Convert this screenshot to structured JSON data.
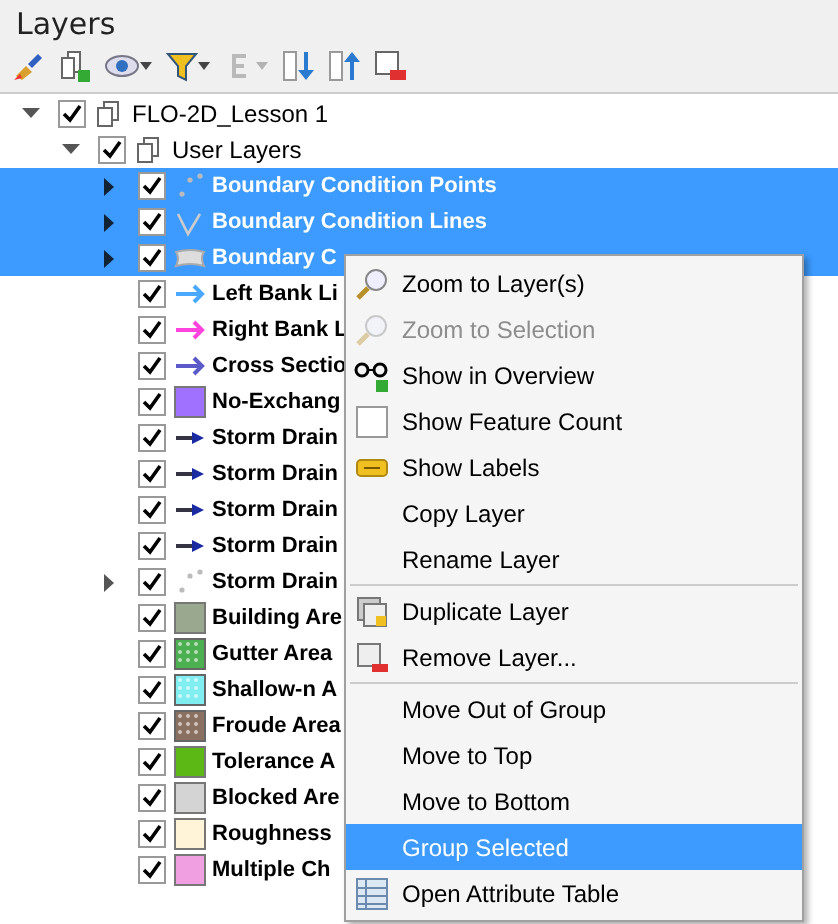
{
  "panel": {
    "title": "Layers"
  },
  "toolbar": [
    {
      "kind": "brush",
      "disabled": false,
      "dropdown": false
    },
    {
      "kind": "add-group",
      "disabled": false,
      "dropdown": false
    },
    {
      "kind": "eye",
      "disabled": false,
      "dropdown": true
    },
    {
      "kind": "filter",
      "disabled": false,
      "dropdown": true
    },
    {
      "kind": "epsilon",
      "disabled": true,
      "dropdown": true
    },
    {
      "kind": "expand",
      "disabled": false,
      "dropdown": false
    },
    {
      "kind": "collapse",
      "disabled": false,
      "dropdown": false
    },
    {
      "kind": "remove",
      "disabled": false,
      "dropdown": false
    }
  ],
  "tree": [
    {
      "label": "FLO-2D_Lesson 1",
      "kind": "group",
      "checked": true,
      "expanded": true,
      "selected": false,
      "children": [
        {
          "label": "User Layers",
          "kind": "group",
          "checked": true,
          "expanded": true,
          "selected": false,
          "children": [
            {
              "label": "Boundary Condition Points",
              "kind": "points",
              "checked": true,
              "collapsed": true,
              "selected": true
            },
            {
              "label": "Boundary Condition Lines",
              "kind": "line",
              "checked": true,
              "collapsed": true,
              "selected": true
            },
            {
              "label": "Boundary C",
              "kind": "polygon",
              "checked": true,
              "collapsed": true,
              "selected": true
            },
            {
              "label": "Left Bank Li",
              "kind": "arrow",
              "color": "#4aa8ff",
              "checked": true,
              "collapsed": false,
              "selected": false
            },
            {
              "label": "Right Bank L",
              "kind": "arrow",
              "color": "#ff44dd",
              "checked": true,
              "collapsed": false,
              "selected": false
            },
            {
              "label": "Cross Sectio",
              "kind": "arrow",
              "color": "#5a5ac8",
              "checked": true,
              "collapsed": false,
              "selected": false
            },
            {
              "label": "No-Exchang",
              "kind": "fill",
              "color": "#a070ff",
              "checked": true,
              "collapsed": false,
              "selected": false
            },
            {
              "label": "Storm Drain",
              "kind": "dart",
              "color": "#333344",
              "checked": true,
              "collapsed": false,
              "selected": false
            },
            {
              "label": "Storm Drain",
              "kind": "dart",
              "color": "#333344",
              "checked": true,
              "collapsed": false,
              "selected": false
            },
            {
              "label": "Storm Drain",
              "kind": "dart",
              "color": "#333344",
              "checked": true,
              "collapsed": false,
              "selected": false
            },
            {
              "label": "Storm Drain",
              "kind": "dart",
              "color": "#333344",
              "checked": true,
              "collapsed": false,
              "selected": false
            },
            {
              "label": "Storm Drain",
              "kind": "points",
              "checked": true,
              "collapsed": true,
              "selected": false
            },
            {
              "label": "Building Are",
              "kind": "fill",
              "color": "#9aa890",
              "checked": true,
              "collapsed": false,
              "selected": false
            },
            {
              "label": "Gutter Area",
              "kind": "pattern",
              "color": "#4caf50",
              "checked": true,
              "collapsed": false,
              "selected": false
            },
            {
              "label": "Shallow-n A",
              "kind": "pattern",
              "color": "#80eef0",
              "checked": true,
              "collapsed": false,
              "selected": false
            },
            {
              "label": "Froude Area",
              "kind": "pattern",
              "color": "#8a7060",
              "checked": true,
              "collapsed": false,
              "selected": false
            },
            {
              "label": "Tolerance A",
              "kind": "fill",
              "color": "#5cb814",
              "checked": true,
              "collapsed": false,
              "selected": false
            },
            {
              "label": "Blocked Are",
              "kind": "fill",
              "color": "#d4d4d4",
              "checked": true,
              "collapsed": false,
              "selected": false
            },
            {
              "label": "Roughness",
              "kind": "fill",
              "color": "#fff3d8",
              "checked": true,
              "collapsed": false,
              "selected": false
            },
            {
              "label": "Multiple Ch",
              "kind": "fill",
              "color": "#f0a0e0",
              "checked": true,
              "collapsed": false,
              "selected": false
            }
          ]
        }
      ]
    }
  ],
  "context_menu": [
    {
      "kind": "item",
      "label": "Zoom to Layer(s)",
      "disabled": false,
      "selected": false
    },
    {
      "kind": "item",
      "label": "Zoom to Selection",
      "disabled": true,
      "selected": false
    },
    {
      "kind": "item",
      "label": "Show in Overview",
      "disabled": false,
      "selected": false
    },
    {
      "kind": "item",
      "label": "Show Feature Count",
      "disabled": false,
      "selected": false
    },
    {
      "kind": "item",
      "label": "Show Labels",
      "disabled": false,
      "selected": false
    },
    {
      "kind": "item",
      "label": "Copy Layer",
      "disabled": false,
      "selected": false
    },
    {
      "kind": "item",
      "label": "Rename Layer",
      "disabled": false,
      "selected": false
    },
    {
      "kind": "separator"
    },
    {
      "kind": "item",
      "label": "Duplicate Layer",
      "disabled": false,
      "selected": false
    },
    {
      "kind": "item",
      "label": "Remove Layer...",
      "disabled": false,
      "selected": false
    },
    {
      "kind": "separator"
    },
    {
      "kind": "item",
      "label": "Move Out of Group",
      "disabled": false,
      "selected": false
    },
    {
      "kind": "item",
      "label": "Move to Top",
      "disabled": false,
      "selected": false
    },
    {
      "kind": "item",
      "label": "Move to Bottom",
      "disabled": false,
      "selected": false
    },
    {
      "kind": "item",
      "label": "Group Selected",
      "disabled": false,
      "selected": true
    },
    {
      "kind": "item",
      "label": "Open Attribute Table",
      "disabled": false,
      "selected": false
    }
  ]
}
